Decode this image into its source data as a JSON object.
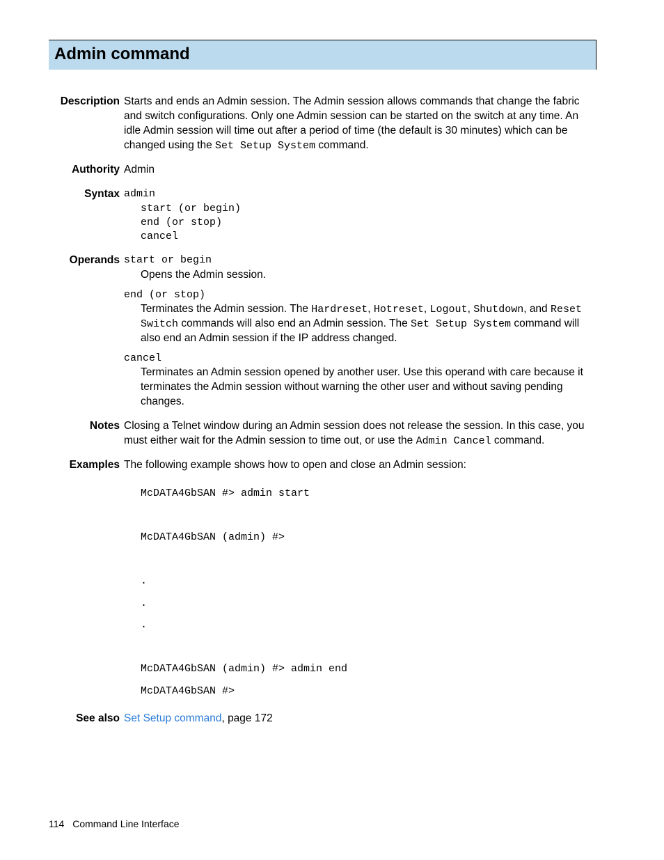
{
  "title": "Admin command",
  "sections": {
    "description": {
      "label": "Description",
      "text_parts": [
        "Starts and ends an Admin session. The Admin session allows commands that change the fabric and switch configurations. Only one Admin session can be started on the switch at any time. An idle Admin session will time out after a period of time (the default is 30 minutes) which can be changed using the ",
        "Set Setup System",
        " command."
      ]
    },
    "authority": {
      "label": "Authority",
      "value": "Admin"
    },
    "syntax": {
      "label": "Syntax",
      "cmd": "admin",
      "lines": [
        "start (or begin)",
        "end (or stop)",
        "cancel"
      ]
    },
    "operands": {
      "label": "Operands",
      "items": [
        {
          "name": "start or begin",
          "desc_parts": [
            "Opens the Admin session."
          ]
        },
        {
          "name": "end (or stop)",
          "desc_parts": [
            "Terminates the Admin session. The ",
            "Hardreset",
            ", ",
            "Hotreset",
            ", ",
            "Logout",
            ", ",
            "Shutdown",
            ", and ",
            "Reset Switch",
            " commands will also end an Admin session. The ",
            "Set Setup System",
            " command will also end an Admin session if the IP address changed."
          ]
        },
        {
          "name": "cancel",
          "desc_parts": [
            "Terminates an Admin session opened by another user. Use this operand with care because it terminates the Admin session without warning the other user and without saving pending changes."
          ]
        }
      ]
    },
    "notes": {
      "label": "Notes",
      "text_parts": [
        "Closing a Telnet window during an Admin session does not release the session. In this case, you must either wait for the Admin session to time out, or use the ",
        "Admin Cancel",
        " command."
      ]
    },
    "examples": {
      "label": "Examples",
      "intro": "The following example shows how to open and close an Admin session:",
      "code": "McDATA4GbSAN #> admin start\n\nMcDATA4GbSAN (admin) #>\n\n.\n.\n.\n\nMcDATA4GbSAN (admin) #> admin end\nMcDATA4GbSAN #>"
    },
    "see_also": {
      "label": "See also",
      "link_text": "Set Setup command",
      "suffix": ", page 172"
    }
  },
  "footer": {
    "page_number": "114",
    "section_title": "Command Line Interface"
  }
}
